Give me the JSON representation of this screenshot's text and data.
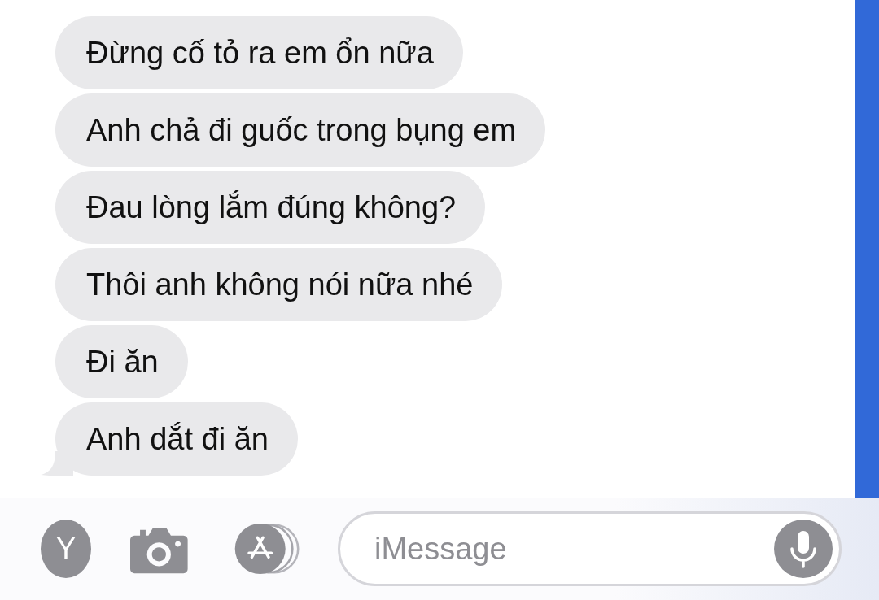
{
  "messages": [
    {
      "text": "Đừng cố tỏ ra em ổn nữa",
      "tail": false
    },
    {
      "text": "Anh chả đi guốc trong bụng em",
      "tail": false
    },
    {
      "text": "Đau lòng lắm đúng không?",
      "tail": false
    },
    {
      "text": "Thôi anh không nói nữa nhé",
      "tail": false
    },
    {
      "text": "Đi ăn",
      "tail": false
    },
    {
      "text": "Anh dắt đi ăn",
      "tail": true
    }
  ],
  "composer": {
    "avatar_letter": "Y",
    "placeholder": "iMessage"
  }
}
